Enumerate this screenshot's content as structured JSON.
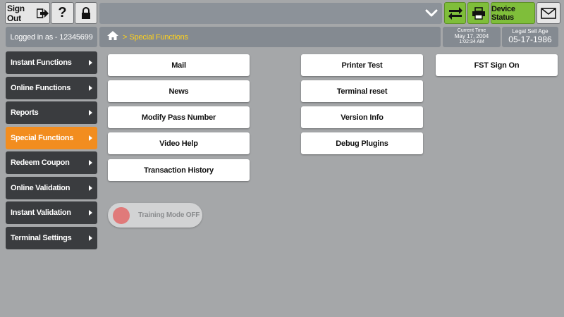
{
  "topbar": {
    "signout_label": "Sign Out",
    "help_label": "?",
    "device_status_label": "Device Status"
  },
  "session": {
    "logged_in_text": "Logged in as - 12345699"
  },
  "breadcrumb": {
    "separator": ">",
    "current": "Special Functions"
  },
  "clock": {
    "label": "Current Time",
    "date": "May 17, 2004",
    "time": "1:02:34 AM"
  },
  "age": {
    "label": "Legal Sell Age",
    "date": "05-17-1986"
  },
  "sidebar": {
    "items": [
      {
        "label": "Instant Functions"
      },
      {
        "label": "Online Functions"
      },
      {
        "label": "Reports"
      },
      {
        "label": "Special Functions"
      },
      {
        "label": "Redeem Coupon"
      },
      {
        "label": "Online Validation"
      },
      {
        "label": "Instant Validation"
      },
      {
        "label": "Terminal Settings"
      }
    ],
    "active_index": 3
  },
  "functions": {
    "col1": [
      {
        "label": "Mail"
      },
      {
        "label": "News"
      },
      {
        "label": "Modify Pass Number"
      },
      {
        "label": "Video Help"
      },
      {
        "label": "Transaction History"
      }
    ],
    "col2": [
      {
        "label": "Printer Test"
      },
      {
        "label": "Terminal reset"
      },
      {
        "label": "Version Info"
      },
      {
        "label": "Debug Plugins"
      }
    ],
    "col3": [
      {
        "label": "FST Sign On"
      }
    ]
  },
  "training": {
    "label": "Training Mode OFF",
    "on": false
  },
  "colors": {
    "background": "#a5a7a9",
    "accent_green": "#7fbe3a",
    "active_orange": "#f28d1f",
    "breadcrumb_yellow": "#ffd21a",
    "sidebar_dark": "#3a3c3f"
  },
  "icons": {
    "signout": "arrow-right-exit-icon",
    "lock": "lock-icon",
    "chevron": "chevron-down-icon",
    "swap": "swap-arrows-icon",
    "printer": "printer-icon",
    "mail": "envelope-icon",
    "home": "home-icon"
  }
}
